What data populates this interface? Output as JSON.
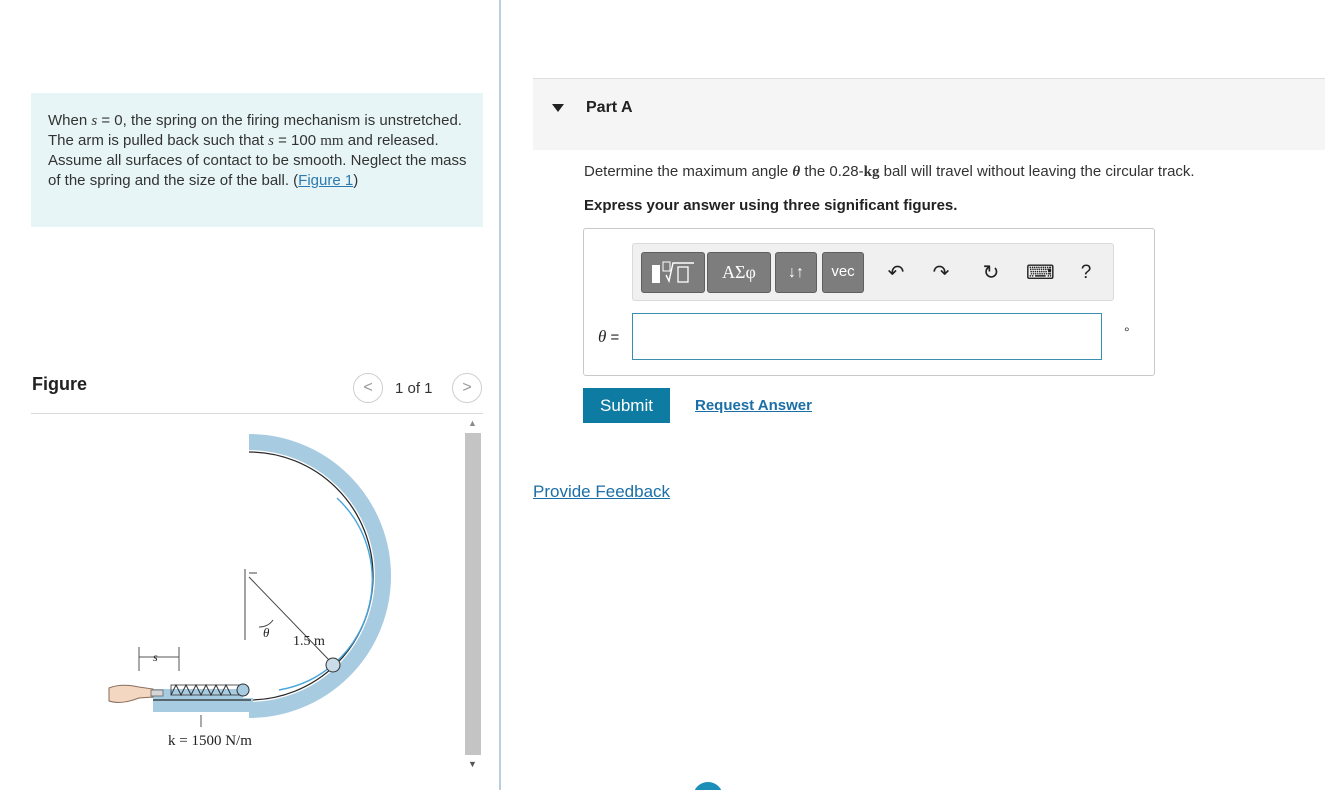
{
  "problem": {
    "t1": "When ",
    "v_s": "s",
    "t2": " = 0, the spring on the firing mechanism is unstretched. The arm is pulled back such that ",
    "v_s2": "s",
    "t3": " = 100 ",
    "u_mm": "mm",
    "t4": " and released. Assume all surfaces of contact to be smooth. Neglect the mass of the spring and the size of the ball. (",
    "link": "Figure 1",
    "t5": ")"
  },
  "figure": {
    "title": "Figure",
    "counter": "1 of 1",
    "prev_glyph": "<",
    "next_glyph": ">",
    "scroll_up_glyph": "▲",
    "scroll_down_glyph": "▼",
    "labels": {
      "theta": "θ",
      "radius": "1.5 m",
      "s": "s",
      "k": "k = 1500 N/m"
    }
  },
  "part": {
    "title": "Part A"
  },
  "question": {
    "t1": "Determine the maximum angle ",
    "theta": "θ",
    "t2": " the 0.28-",
    "kg": "kg",
    "t3": " ball will travel without leaving the circular track."
  },
  "instruction": "Express your answer using three significant figures.",
  "toolbar": {
    "greek": "ΑΣφ",
    "arrows": "↓↑",
    "vec": "vec",
    "undo": "↶",
    "redo": "↷",
    "reset": "↻",
    "keyboard": "⌨",
    "help": "?"
  },
  "answer": {
    "label_var": "θ",
    "label_eq": " =",
    "value": "",
    "unit": "°"
  },
  "buttons": {
    "submit": "Submit",
    "request": "Request Answer",
    "feedback": "Provide Feedback"
  }
}
